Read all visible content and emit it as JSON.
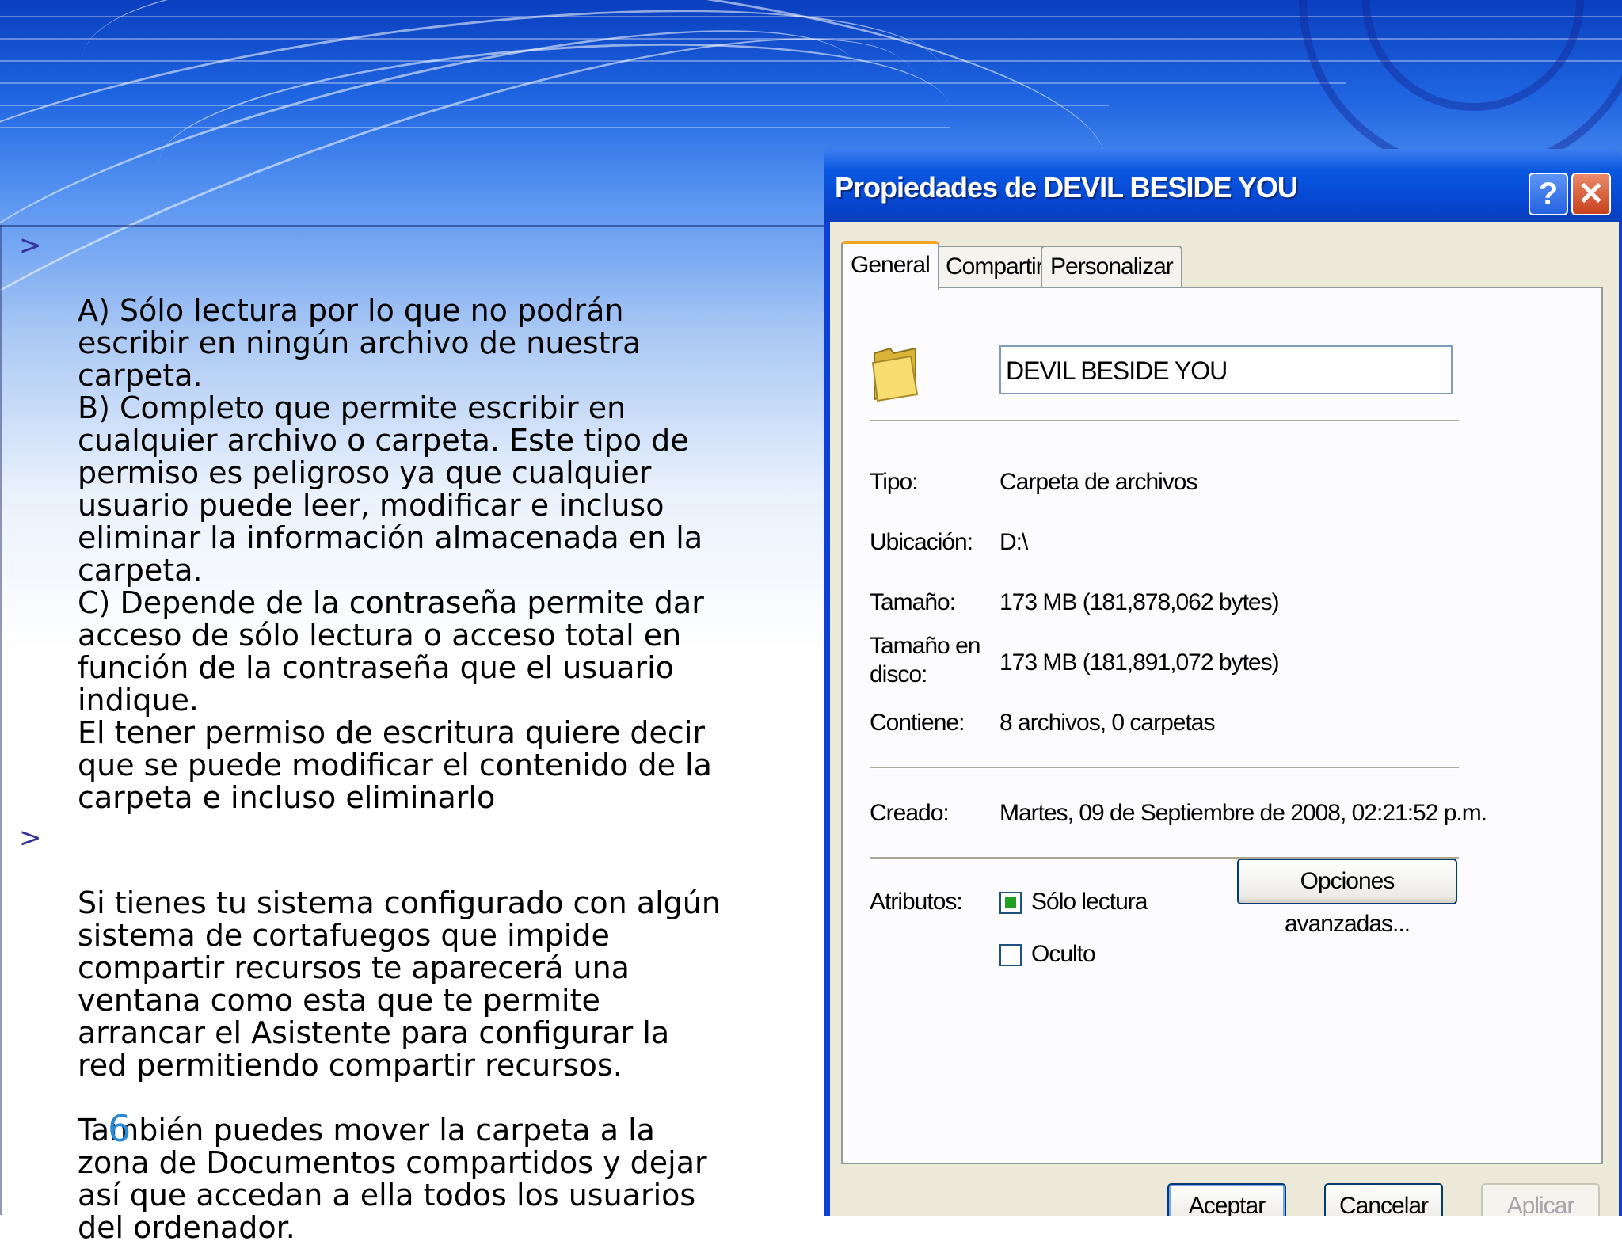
{
  "slide": {
    "bullets": [
      "A) Sólo lectura por lo que no podrán\nescribir en ningún archivo de nuestra\ncarpeta.\nB) Completo que permite escribir en\ncualquier archivo o carpeta. Este tipo de\npermiso es peligroso ya que cualquier\nusuario puede leer, modificar e incluso\neliminar la información almacenada en la\ncarpeta.\nC) Depende de la contraseña permite dar\nacceso de sólo lectura o acceso total en\nfunción de la contraseña que el usuario\nindique.\nEl tener permiso de escritura quiere decir\nque se puede modificar el contenido de la\ncarpeta e incluso eliminarlo",
      "Si tienes tu sistema configurado con algún\nsistema de cortafuegos que impide\ncompartir recursos te aparecerá una\nventana como esta que te permite\narrancar el Asistente para configurar la\nred permitiendo compartir recursos.\n\nTambién puedes mover la carpeta a la\nzona de Documentos compartidos y dejar\nasí que accedan a ella todos los usuarios\ndel ordenador."
    ],
    "bullet_glyph": ">",
    "page_number": "6"
  },
  "dialog": {
    "title": "Propiedades de DEVIL BESIDE YOU",
    "help_glyph": "?",
    "close_glyph": "✕",
    "tabs": [
      {
        "label": "General",
        "active": true
      },
      {
        "label": "Compartir",
        "active": false
      },
      {
        "label": "Personalizar",
        "active": false
      }
    ],
    "folder_name": "DEVIL BESIDE YOU",
    "props": {
      "tipo": {
        "label": "Tipo:",
        "value": "Carpeta de archivos"
      },
      "ubicacion": {
        "label": "Ubicación:",
        "value": "D:\\"
      },
      "tamano": {
        "label": "Tamaño:",
        "value": "173 MB (181,878,062 bytes)"
      },
      "tamano_disco": {
        "label": "Tamaño en\ndisco:",
        "value": "173 MB (181,891,072 bytes)"
      },
      "contiene": {
        "label": "Contiene:",
        "value": "8 archivos, 0 carpetas"
      },
      "creado": {
        "label": "Creado:",
        "value": "Martes, 09 de Septiembre de 2008, 02:21:52 p.m."
      }
    },
    "attributes": {
      "label": "Atributos:",
      "readonly": {
        "label": "Sólo lectura",
        "state": "indeterminate"
      },
      "hidden": {
        "label": "Oculto",
        "checked": false
      },
      "advanced_button": "Opciones avanzadas..."
    },
    "buttons": {
      "ok": "Aceptar",
      "cancel": "Cancelar",
      "apply": "Aplicar"
    }
  },
  "colors": {
    "titlebar": "#0645cf",
    "dialog_face": "#ece9d8",
    "tab_highlight": "#f7a324",
    "page_number": "#2a8ad4",
    "bullet": "#333399"
  }
}
